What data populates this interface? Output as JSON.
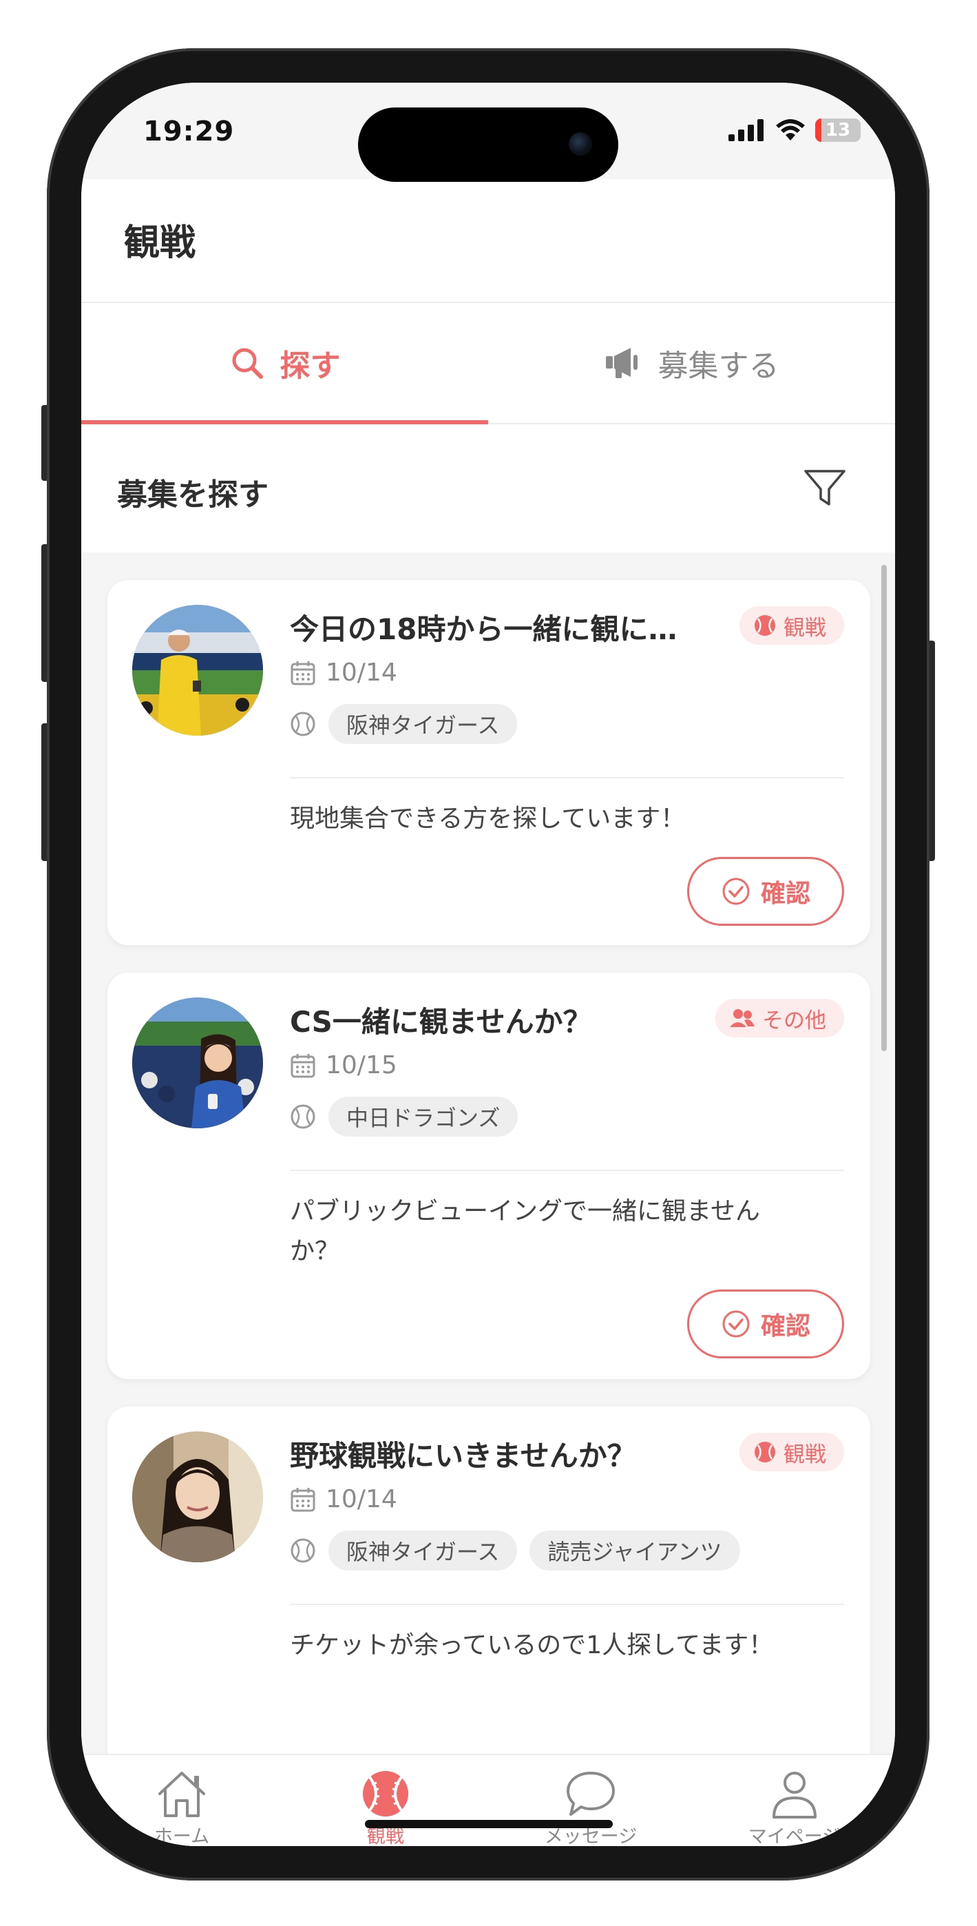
{
  "status_bar": {
    "time": "19:29",
    "battery": "13"
  },
  "header": {
    "title": "観戦"
  },
  "tabs": [
    {
      "label": "探す",
      "icon": "search-icon",
      "active": true
    },
    {
      "label": "募集する",
      "icon": "megaphone-icon",
      "active": false
    }
  ],
  "section": {
    "title": "募集を探す",
    "filter_icon": "filter-icon"
  },
  "colors": {
    "accent": "#f06a6a",
    "tag_bg": "#fdecec",
    "chip_bg": "#eeeeee",
    "list_bg": "#f5f5f5"
  },
  "posts": [
    {
      "title": "今日の18時から一緒に観に…",
      "tag": "観戦",
      "tag_icon": "baseball-icon",
      "date": "10/14",
      "teams": [
        "阪神タイガース"
      ],
      "message": "現地集合できる方を探しています！",
      "button": "確認"
    },
    {
      "title": "CS一緒に観ませんか？",
      "tag": "その他",
      "tag_icon": "people-icon",
      "date": "10/15",
      "teams": [
        "中日ドラゴンズ"
      ],
      "message": "パブリックビューイングで一緒に観ませんか？",
      "button": "確認"
    },
    {
      "title": "野球観戦にいきませんか？",
      "tag": "観戦",
      "tag_icon": "baseball-icon",
      "date": "10/14",
      "teams": [
        "阪神タイガース",
        "読売ジャイアンツ"
      ],
      "message": "チケットが余っているので1人探してます！"
    }
  ],
  "bottom_nav": [
    {
      "label": "ホーム",
      "icon": "home-icon",
      "active": false
    },
    {
      "label": "観戦",
      "icon": "baseball-icon",
      "active": true
    },
    {
      "label": "メッセージ",
      "icon": "chat-icon",
      "active": false
    },
    {
      "label": "マイページ",
      "icon": "user-icon",
      "active": false
    }
  ]
}
